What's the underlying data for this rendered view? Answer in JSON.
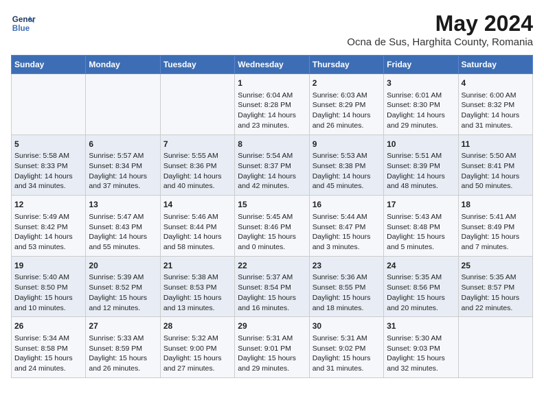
{
  "logo": {
    "line1": "General",
    "line2": "Blue"
  },
  "title": "May 2024",
  "subtitle": "Ocna de Sus, Harghita County, Romania",
  "days_header": [
    "Sunday",
    "Monday",
    "Tuesday",
    "Wednesday",
    "Thursday",
    "Friday",
    "Saturday"
  ],
  "weeks": [
    [
      {
        "day": "",
        "content": ""
      },
      {
        "day": "",
        "content": ""
      },
      {
        "day": "",
        "content": ""
      },
      {
        "day": "1",
        "content": "Sunrise: 6:04 AM\nSunset: 8:28 PM\nDaylight: 14 hours\nand 23 minutes."
      },
      {
        "day": "2",
        "content": "Sunrise: 6:03 AM\nSunset: 8:29 PM\nDaylight: 14 hours\nand 26 minutes."
      },
      {
        "day": "3",
        "content": "Sunrise: 6:01 AM\nSunset: 8:30 PM\nDaylight: 14 hours\nand 29 minutes."
      },
      {
        "day": "4",
        "content": "Sunrise: 6:00 AM\nSunset: 8:32 PM\nDaylight: 14 hours\nand 31 minutes."
      }
    ],
    [
      {
        "day": "5",
        "content": "Sunrise: 5:58 AM\nSunset: 8:33 PM\nDaylight: 14 hours\nand 34 minutes."
      },
      {
        "day": "6",
        "content": "Sunrise: 5:57 AM\nSunset: 8:34 PM\nDaylight: 14 hours\nand 37 minutes."
      },
      {
        "day": "7",
        "content": "Sunrise: 5:55 AM\nSunset: 8:36 PM\nDaylight: 14 hours\nand 40 minutes."
      },
      {
        "day": "8",
        "content": "Sunrise: 5:54 AM\nSunset: 8:37 PM\nDaylight: 14 hours\nand 42 minutes."
      },
      {
        "day": "9",
        "content": "Sunrise: 5:53 AM\nSunset: 8:38 PM\nDaylight: 14 hours\nand 45 minutes."
      },
      {
        "day": "10",
        "content": "Sunrise: 5:51 AM\nSunset: 8:39 PM\nDaylight: 14 hours\nand 48 minutes."
      },
      {
        "day": "11",
        "content": "Sunrise: 5:50 AM\nSunset: 8:41 PM\nDaylight: 14 hours\nand 50 minutes."
      }
    ],
    [
      {
        "day": "12",
        "content": "Sunrise: 5:49 AM\nSunset: 8:42 PM\nDaylight: 14 hours\nand 53 minutes."
      },
      {
        "day": "13",
        "content": "Sunrise: 5:47 AM\nSunset: 8:43 PM\nDaylight: 14 hours\nand 55 minutes."
      },
      {
        "day": "14",
        "content": "Sunrise: 5:46 AM\nSunset: 8:44 PM\nDaylight: 14 hours\nand 58 minutes."
      },
      {
        "day": "15",
        "content": "Sunrise: 5:45 AM\nSunset: 8:46 PM\nDaylight: 15 hours\nand 0 minutes."
      },
      {
        "day": "16",
        "content": "Sunrise: 5:44 AM\nSunset: 8:47 PM\nDaylight: 15 hours\nand 3 minutes."
      },
      {
        "day": "17",
        "content": "Sunrise: 5:43 AM\nSunset: 8:48 PM\nDaylight: 15 hours\nand 5 minutes."
      },
      {
        "day": "18",
        "content": "Sunrise: 5:41 AM\nSunset: 8:49 PM\nDaylight: 15 hours\nand 7 minutes."
      }
    ],
    [
      {
        "day": "19",
        "content": "Sunrise: 5:40 AM\nSunset: 8:50 PM\nDaylight: 15 hours\nand 10 minutes."
      },
      {
        "day": "20",
        "content": "Sunrise: 5:39 AM\nSunset: 8:52 PM\nDaylight: 15 hours\nand 12 minutes."
      },
      {
        "day": "21",
        "content": "Sunrise: 5:38 AM\nSunset: 8:53 PM\nDaylight: 15 hours\nand 13 minutes."
      },
      {
        "day": "22",
        "content": "Sunrise: 5:37 AM\nSunset: 8:54 PM\nDaylight: 15 hours\nand 16 minutes."
      },
      {
        "day": "23",
        "content": "Sunrise: 5:36 AM\nSunset: 8:55 PM\nDaylight: 15 hours\nand 18 minutes."
      },
      {
        "day": "24",
        "content": "Sunrise: 5:35 AM\nSunset: 8:56 PM\nDaylight: 15 hours\nand 20 minutes."
      },
      {
        "day": "25",
        "content": "Sunrise: 5:35 AM\nSunset: 8:57 PM\nDaylight: 15 hours\nand 22 minutes."
      }
    ],
    [
      {
        "day": "26",
        "content": "Sunrise: 5:34 AM\nSunset: 8:58 PM\nDaylight: 15 hours\nand 24 minutes."
      },
      {
        "day": "27",
        "content": "Sunrise: 5:33 AM\nSunset: 8:59 PM\nDaylight: 15 hours\nand 26 minutes."
      },
      {
        "day": "28",
        "content": "Sunrise: 5:32 AM\nSunset: 9:00 PM\nDaylight: 15 hours\nand 27 minutes."
      },
      {
        "day": "29",
        "content": "Sunrise: 5:31 AM\nSunset: 9:01 PM\nDaylight: 15 hours\nand 29 minutes."
      },
      {
        "day": "30",
        "content": "Sunrise: 5:31 AM\nSunset: 9:02 PM\nDaylight: 15 hours\nand 31 minutes."
      },
      {
        "day": "31",
        "content": "Sunrise: 5:30 AM\nSunset: 9:03 PM\nDaylight: 15 hours\nand 32 minutes."
      },
      {
        "day": "",
        "content": ""
      }
    ]
  ]
}
